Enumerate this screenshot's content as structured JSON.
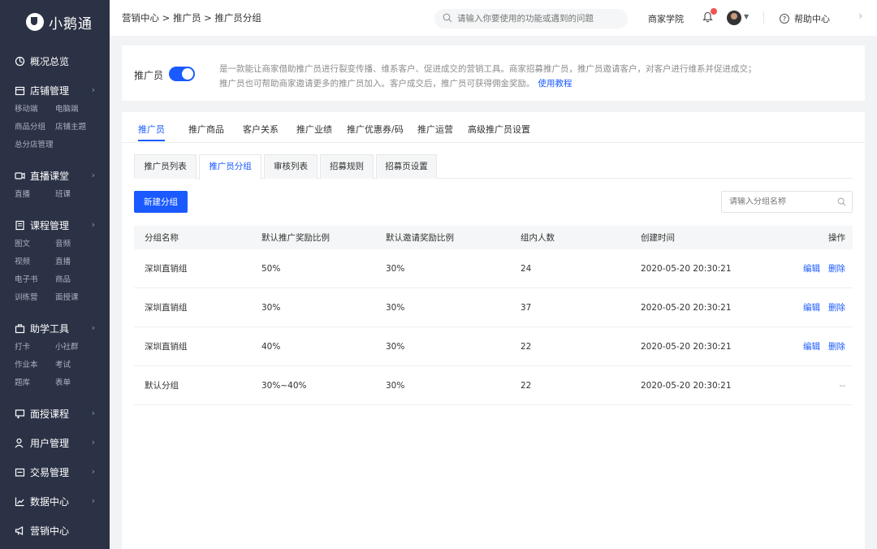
{
  "app": {
    "logo_text": "小鹅通"
  },
  "sidebar": {
    "groups": [
      {
        "label": "概况总览",
        "icon": "dashboard-icon",
        "sub": []
      },
      {
        "label": "店铺管理",
        "icon": "store-icon",
        "sub": [
          "移动端",
          "电脑端",
          "商品分组",
          "店铺主题",
          "总分店管理"
        ]
      },
      {
        "label": "直播课堂",
        "icon": "live-icon",
        "sub": [
          "直播",
          "班课"
        ]
      },
      {
        "label": "课程管理",
        "icon": "course-icon",
        "sub": [
          "图文",
          "音频",
          "视频",
          "直播",
          "电子书",
          "商品",
          "训练营",
          "面授课"
        ]
      },
      {
        "label": "助学工具",
        "icon": "toolbox-icon",
        "sub": [
          "打卡",
          "小社群",
          "作业本",
          "考试",
          "题库",
          "表单"
        ]
      },
      {
        "label": "面授课程",
        "icon": "classroom-icon",
        "sub": []
      },
      {
        "label": "用户管理",
        "icon": "user-icon",
        "sub": []
      },
      {
        "label": "交易管理",
        "icon": "trade-icon",
        "sub": []
      },
      {
        "label": "数据中心",
        "icon": "chart-icon",
        "sub": []
      },
      {
        "label": "营销中心",
        "icon": "megaphone-icon",
        "sub": []
      }
    ]
  },
  "topbar": {
    "breadcrumb": "营销中心 > 推广员 > 推广员分组",
    "search_placeholder": "请输入你要使用的功能或遇到的问题",
    "merchant_school": "商家学院",
    "help_center": "帮助中心"
  },
  "intro": {
    "label": "推广员",
    "toggle_on": true,
    "desc_line1": "是一款能让商家借助推广员进行裂变传播、维系客户、促进成交的营销工具。商家招募推广员，推广员邀请客户，对客户进行维系并促进成交；",
    "desc_line2": "推广员也可帮助商家邀请更多的推广员加入。客户成交后，推广员可获得佣金奖励。",
    "link": "使用教程"
  },
  "tabs": [
    "推广员",
    "推广商品",
    "客户关系",
    "推广业绩",
    "推广优惠券/码",
    "推广运营",
    "高级推广员设置"
  ],
  "subtabs": [
    "推广员列表",
    "推广员分组",
    "审核列表",
    "招募规则",
    "招募页设置"
  ],
  "toolbar": {
    "new_group": "新建分组",
    "search_placeholder": "请输入分组名称"
  },
  "table": {
    "headers": [
      "分组名称",
      "默认推广奖励比例",
      "默认邀请奖励比例",
      "组内人数",
      "创建时间",
      "操作"
    ],
    "rows": [
      {
        "name": "深圳直销组",
        "promo": "50%",
        "invite": "30%",
        "count": "24",
        "created": "2020-05-20 20:30:21",
        "ops": [
          "编辑",
          "删除"
        ]
      },
      {
        "name": "深圳直销组",
        "promo": "30%",
        "invite": "30%",
        "count": "37",
        "created": "2020-05-20 20:30:21",
        "ops": [
          "编辑",
          "删除"
        ]
      },
      {
        "name": "深圳直销组",
        "promo": "40%",
        "invite": "30%",
        "count": "22",
        "created": "2020-05-20 20:30:21",
        "ops": [
          "编辑",
          "删除"
        ]
      },
      {
        "name": "默认分组",
        "promo": "30%~40%",
        "invite": "30%",
        "count": "22",
        "created": "2020-05-20 20:30:21",
        "ops": [
          "--"
        ]
      }
    ]
  },
  "colors": {
    "accent": "#1a5aff",
    "sidebar_bg": "#2b3245",
    "badge": "#f05454"
  }
}
